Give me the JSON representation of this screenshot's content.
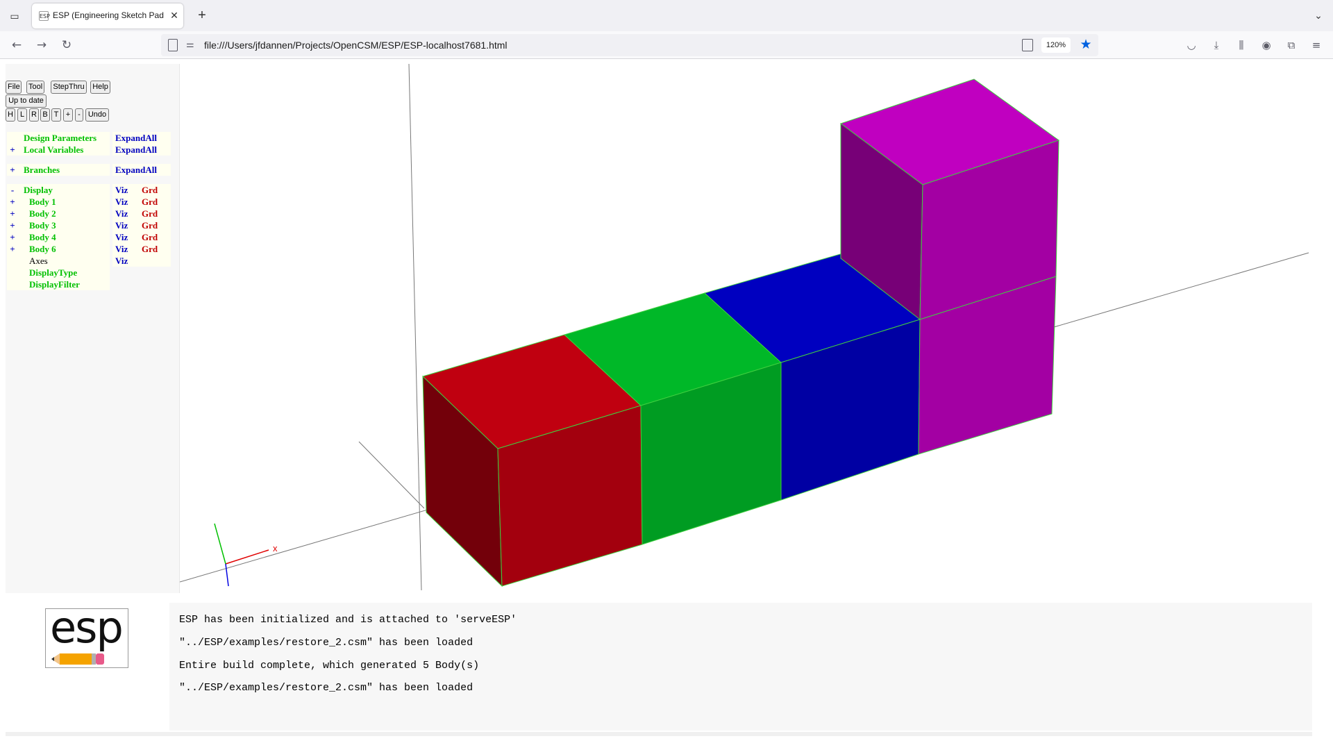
{
  "browser": {
    "tab_title": "ESP (Engineering Sketch Pad, V",
    "tab_favicon": "ESP",
    "url": "file:///Users/jfdannen/Projects/OpenCSM/ESP/ESP-localhost7681.html",
    "zoom": "120%"
  },
  "toolbar": {
    "file": "File",
    "tool": "Tool",
    "stepthru": "StepThru",
    "help": "Help",
    "status": "Up to date",
    "view_h": "H",
    "view_l": "L",
    "view_r": "R",
    "view_b": "B",
    "view_t": "T",
    "zoom_in": "+",
    "zoom_out": "-",
    "undo": "Undo"
  },
  "tree": {
    "design_parameters": {
      "sign": "",
      "label": "Design Parameters",
      "action": "ExpandAll"
    },
    "local_variables": {
      "sign": "+",
      "label": "Local Variables",
      "action": "ExpandAll"
    },
    "branches": {
      "sign": "+",
      "label": "Branches",
      "action": "ExpandAll"
    },
    "display": {
      "sign": "-",
      "label": "Display",
      "viz": "Viz",
      "grd": "Grd"
    },
    "bodies": [
      {
        "sign": "+",
        "label": "Body 1",
        "viz": "Viz",
        "grd": "Grd"
      },
      {
        "sign": "+",
        "label": "Body 2",
        "viz": "Viz",
        "grd": "Grd"
      },
      {
        "sign": "+",
        "label": "Body 3",
        "viz": "Viz",
        "grd": "Grd"
      },
      {
        "sign": "+",
        "label": "Body 4",
        "viz": "Viz",
        "grd": "Grd"
      },
      {
        "sign": "+",
        "label": "Body 6",
        "viz": "Viz",
        "grd": "Grd"
      }
    ],
    "axes": {
      "label": "Axes",
      "viz": "Viz"
    },
    "display_type": "DisplayType",
    "display_filter": "DisplayFilter"
  },
  "scene": {
    "colors": {
      "red": "#c00010",
      "green": "#00b828",
      "blue": "#0000c0",
      "magenta": "#c000c0",
      "edges": "#40d040"
    }
  },
  "logo_text": "esp",
  "messages": [
    "ESP has been initialized and is attached to 'serveESP'",
    "\"../ESP/examples/restore_2.csm\" has been loaded",
    "Entire build complete, which generated 5 Body(s)",
    "\"../ESP/examples/restore_2.csm\" has been loaded"
  ]
}
